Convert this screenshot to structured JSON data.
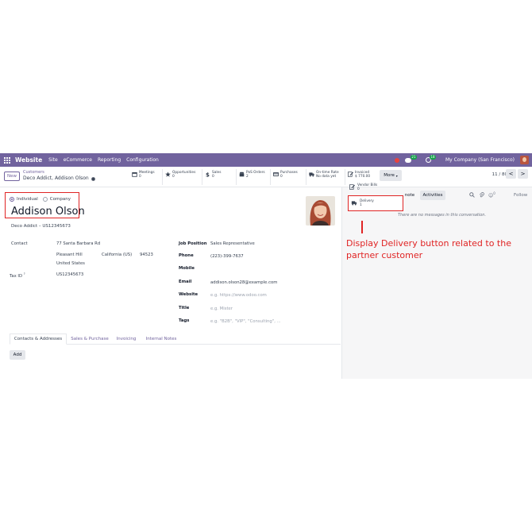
{
  "nav": {
    "app_name": "Website",
    "menu": [
      "Site",
      "eCommerce",
      "Reporting",
      "Configuration"
    ],
    "chat_count": "21",
    "activity_count": "18",
    "company": "My Company (San Francisco)"
  },
  "control": {
    "new_label": "New",
    "breadcrumb": "Customers",
    "record_title": "Deco Addict, Addison Olson",
    "more_label": "More",
    "pager": "11 / 80",
    "prev": "<",
    "next": ">"
  },
  "stats": [
    {
      "label": "Meetings",
      "value": "0",
      "icon": "calendar-icon"
    },
    {
      "label": "Opportunities",
      "value": "0",
      "icon": "star-icon"
    },
    {
      "label": "Sales",
      "value": "0",
      "icon": "dollar-icon"
    },
    {
      "label": "PoS Orders",
      "value": "2",
      "icon": "shop-icon"
    },
    {
      "label": "Purchases",
      "value": "0",
      "icon": "credit-card-icon"
    },
    {
      "label": "On-time Rate",
      "value": "No data yet",
      "icon": "truck-icon"
    },
    {
      "label": "Invoiced",
      "value": "$ 770.00",
      "icon": "pencil-icon"
    }
  ],
  "form": {
    "individual": "Individual",
    "company": "Company",
    "name": "Addison Olson",
    "company_line": "Deco Addict – US12345673",
    "contact_label": "Contact",
    "street": "77 Santa Barbara Rd",
    "city": "Pleasant Hill",
    "state": "California (US)",
    "zip": "94523",
    "country": "United States",
    "tax_label": "Tax ID",
    "tax_sup": "?",
    "tax_value": "US12345673",
    "job_label": "Job Position",
    "job_value": "Sales Representative",
    "phone_label": "Phone",
    "phone_value": "(223)-399-7637",
    "mobile_label": "Mobile",
    "email_label": "Email",
    "email_value": "addison.olson28@example.com",
    "website_label": "Website",
    "website_placeholder": "e.g. https://www.odoo.com",
    "title_label": "Title",
    "title_placeholder": "e.g. Mister",
    "tags_label": "Tags",
    "tags_placeholder": "e.g. \"B2B\", \"VIP\", \"Consulting\", ..."
  },
  "tabs": [
    "Contacts & Addresses",
    "Sales & Purchase",
    "Invoicing",
    "Internal Notes"
  ],
  "add_label": "Add",
  "chatter": {
    "note_label": "note",
    "activities_label": "Activities",
    "follower_count": "0",
    "follow_label": "Follow",
    "no_messages": "There are no messages in this conversation."
  },
  "smart_buttons": {
    "vendor_bills_label": "Vendor Bills",
    "vendor_bills_value": "0",
    "delivery_label": "Delivery",
    "delivery_value": "1"
  },
  "annotation": "Display Delivery button related to the partner customer",
  "colors": {
    "brand": "#71639e",
    "highlight": "#e02424"
  }
}
